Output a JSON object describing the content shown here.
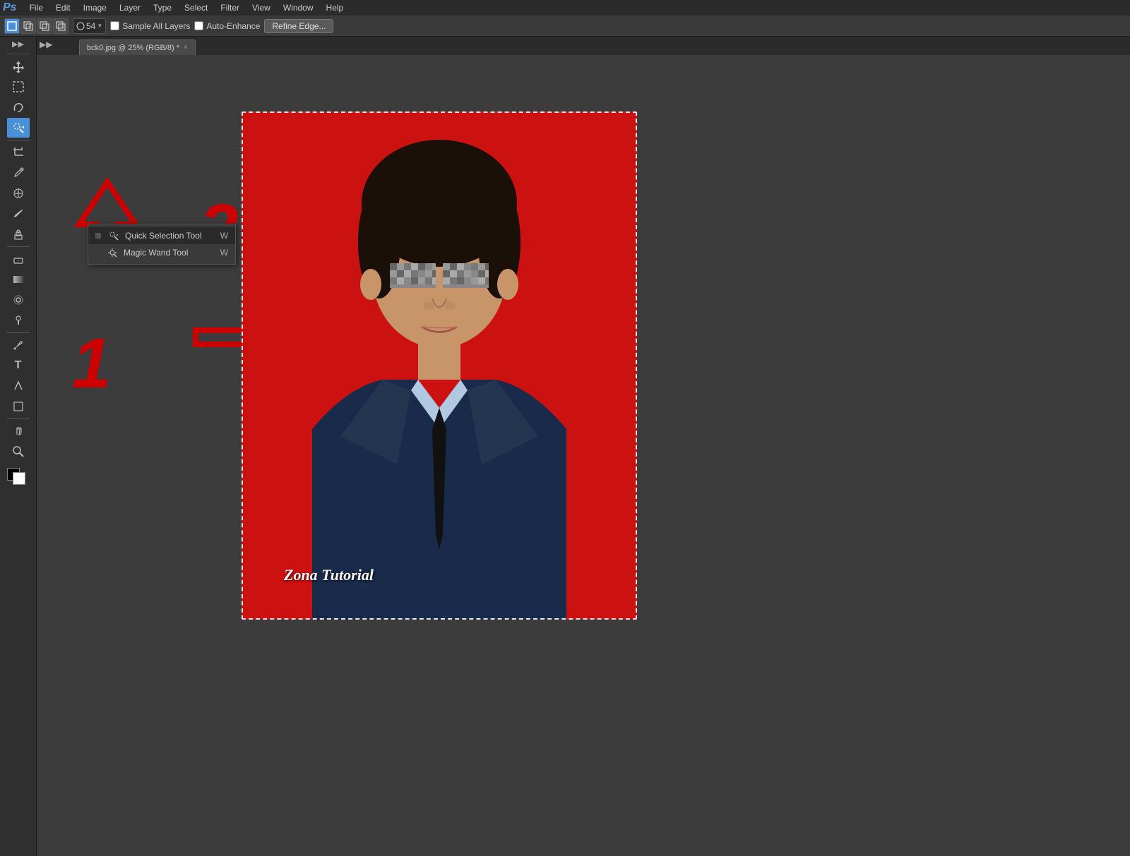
{
  "menu": {
    "logo": "Ps",
    "items": [
      "File",
      "Edit",
      "Image",
      "Layer",
      "Type",
      "Select",
      "Filter",
      "View",
      "Window",
      "Help"
    ]
  },
  "options_bar": {
    "brush_size": "54",
    "sample_all_layers_label": "Sample All Layers",
    "auto_enhance_label": "Auto-Enhance",
    "refine_edge_label": "Refine Edge...",
    "sample_all_layers_checked": false,
    "auto_enhance_checked": false
  },
  "document_tab": {
    "name": "bck0.jpg @ 25% (RGB/8) *",
    "close_symbol": "×"
  },
  "tool_popup": {
    "items": [
      {
        "label": "Quick Selection Tool",
        "shortcut": "W",
        "active": true
      },
      {
        "label": "Magic Wand Tool",
        "shortcut": "W",
        "active": false
      }
    ]
  },
  "annotations": {
    "number_1": "1",
    "number_2": "2"
  },
  "watermark": "Zona Tutorial",
  "canvas": {
    "background_color": "#cc1111"
  },
  "toolbar": {
    "tools": [
      "move",
      "marquee",
      "lasso",
      "quick-selection",
      "crop",
      "eyedropper",
      "healing",
      "brush",
      "stamp",
      "history-brush",
      "eraser",
      "gradient",
      "blur",
      "dodge",
      "pen",
      "text",
      "path-selection",
      "shape",
      "hand",
      "zoom"
    ]
  }
}
